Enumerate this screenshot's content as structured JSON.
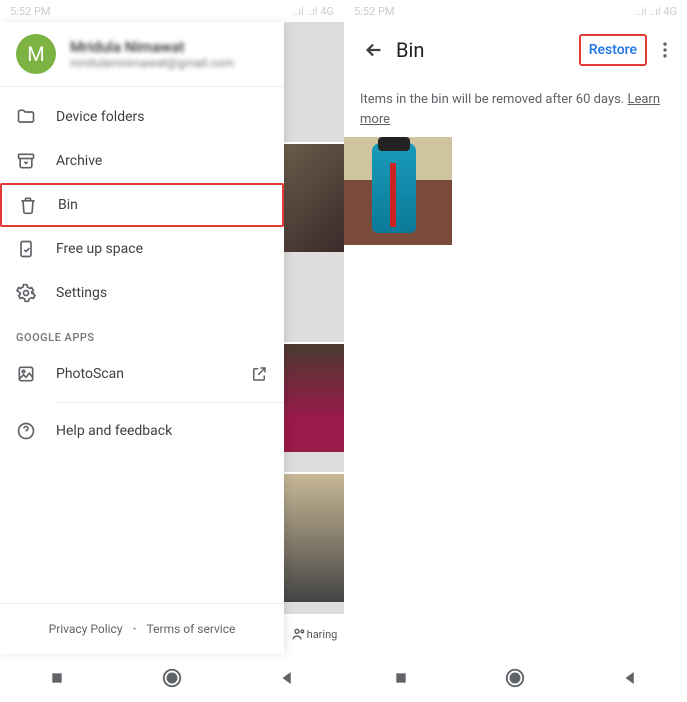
{
  "status": {
    "time": "5:52 PM",
    "signal": "..ıl ..ıl 4G"
  },
  "account": {
    "initial": "M",
    "name": "Mridula Nimawat",
    "email": "mridulamnimawat@gmail.com"
  },
  "menu": {
    "device_folders": "Device folders",
    "archive": "Archive",
    "bin": "Bin",
    "free_up": "Free up space",
    "settings": "Settings"
  },
  "google_apps": "GOOGLE APPS",
  "photoscan": "PhotoScan",
  "help": "Help and feedback",
  "footer": {
    "privacy": "Privacy Policy",
    "terms": "Terms of service"
  },
  "bg": {
    "sharing": "haring"
  },
  "right": {
    "title": "Bin",
    "restore": "Restore",
    "notice_pre": "Items in the bin will be removed after 60 days. ",
    "learn": "Learn more"
  }
}
